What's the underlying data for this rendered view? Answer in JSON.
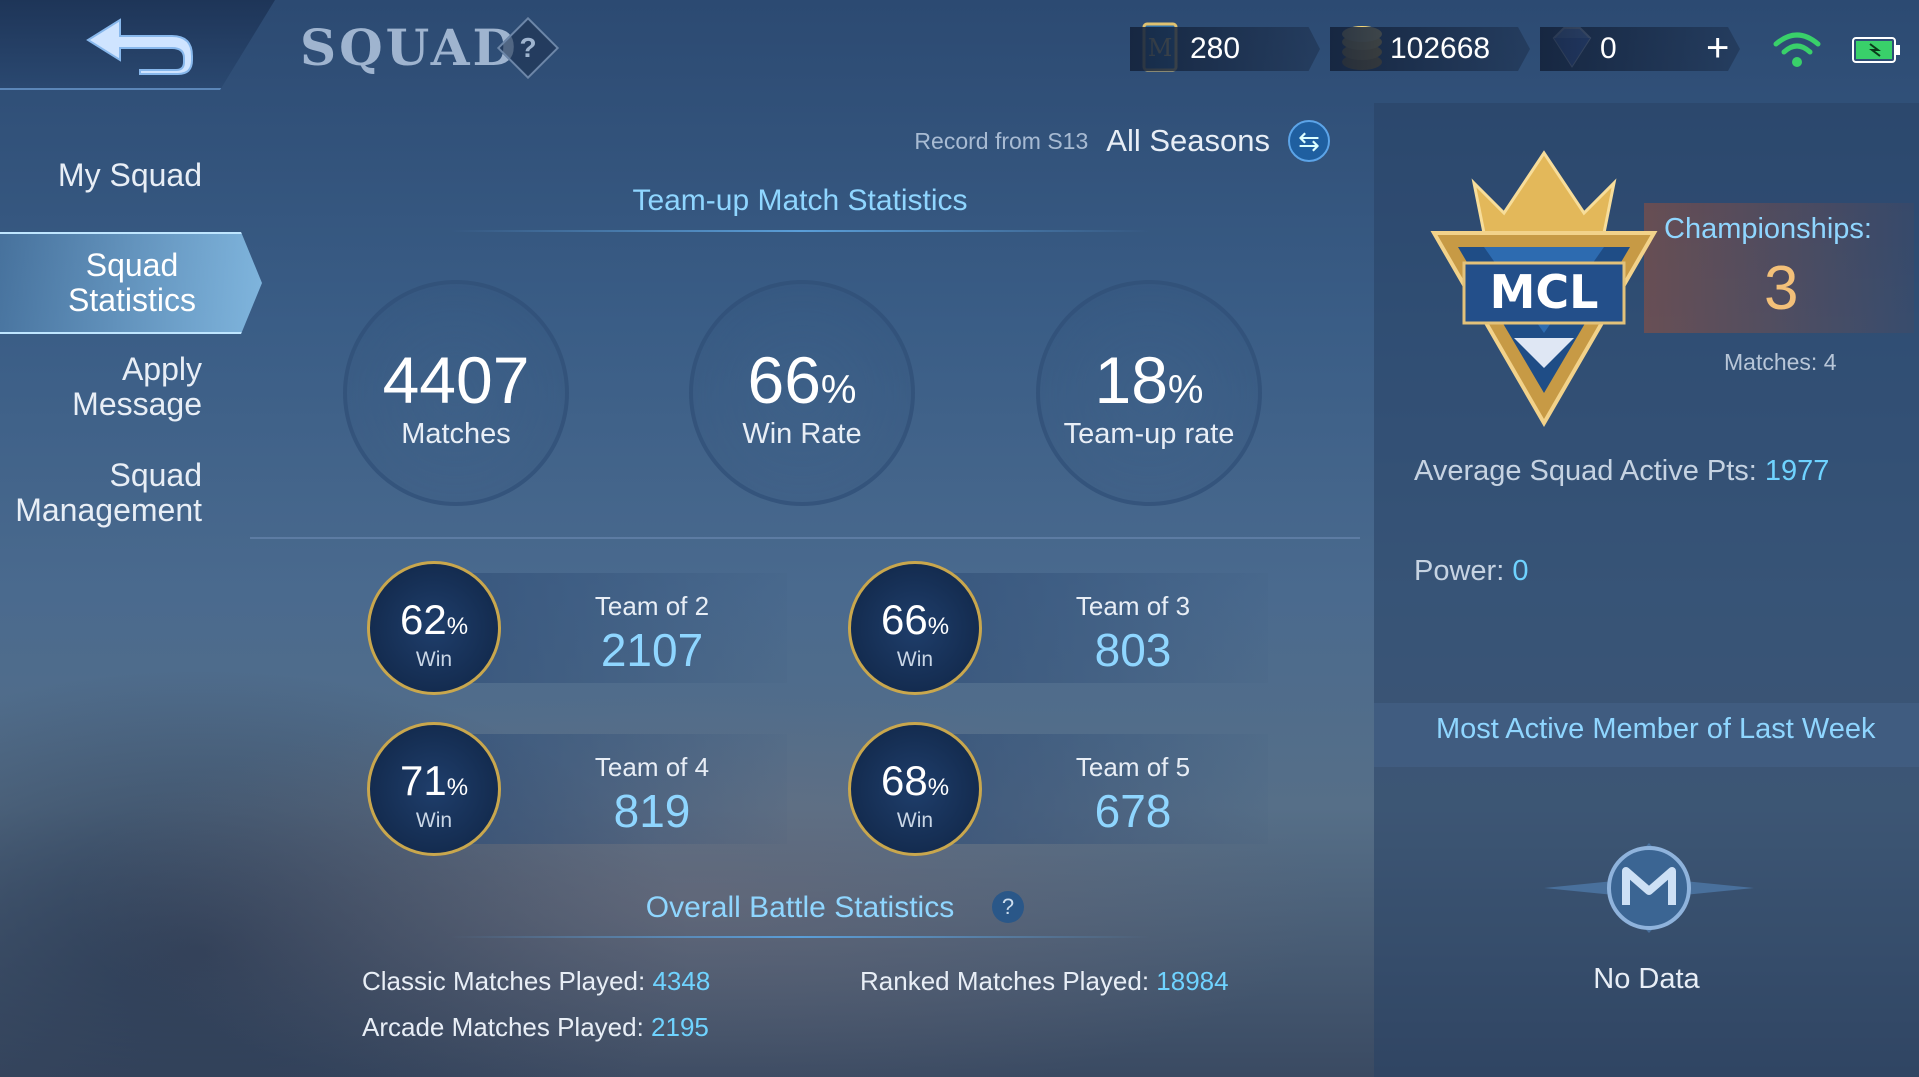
{
  "header": {
    "title": "SQUAD",
    "help": "?",
    "tickets": "280",
    "gold": "102668",
    "diamonds": "0",
    "add": "+"
  },
  "sidebar": {
    "items": [
      {
        "label": "My Squad"
      },
      {
        "label": "Squad Statistics"
      },
      {
        "label": "Apply Message"
      },
      {
        "label": "Squad Management"
      }
    ]
  },
  "record": {
    "label": "Record from S13",
    "season": "All Seasons"
  },
  "teamup": {
    "title": "Team-up Match Statistics",
    "matches_value": "4407",
    "matches_label": "Matches",
    "winrate_value": "66",
    "winrate_unit": "%",
    "winrate_label": "Win Rate",
    "teamup_value": "18",
    "teamup_unit": "%",
    "teamup_label": "Team-up rate"
  },
  "teams": [
    {
      "pct": "62",
      "unit": "%",
      "win": "Win",
      "name": "Team of 2",
      "count": "2107"
    },
    {
      "pct": "66",
      "unit": "%",
      "win": "Win",
      "name": "Team of 3",
      "count": "803"
    },
    {
      "pct": "71",
      "unit": "%",
      "win": "Win",
      "name": "Team of 4",
      "count": "819"
    },
    {
      "pct": "68",
      "unit": "%",
      "win": "Win",
      "name": "Team of 5",
      "count": "678"
    }
  ],
  "overall": {
    "title": "Overall Battle Statistics",
    "help": "?",
    "classic_label": "Classic Matches Played: ",
    "classic_value": "4348",
    "ranked_label": "Ranked Matches Played: ",
    "ranked_value": "18984",
    "arcade_label": "Arcade Matches Played: ",
    "arcade_value": "2195"
  },
  "right": {
    "emblem_text": "MCL",
    "championships_label": "Championships:",
    "championships_value": "3",
    "matches": "Matches: 4",
    "avg_label": "Average Squad Active Pts: ",
    "avg_value": "1977",
    "power_label": "Power: ",
    "power_value": "0",
    "most_active": "Most Active Member of Last Week",
    "no_data": "No Data"
  },
  "colors": {
    "accent": "#8fd6ff",
    "value": "#6fd3ff",
    "gold": "#c9a74d",
    "championship": "#f3c079"
  },
  "icons": [
    "back-arrow-icon",
    "ticket-icon",
    "gold-coin-icon",
    "diamond-icon",
    "plus-icon",
    "wifi-icon",
    "battery-icon",
    "swap-icon",
    "mcl-emblem",
    "ml-logo"
  ]
}
